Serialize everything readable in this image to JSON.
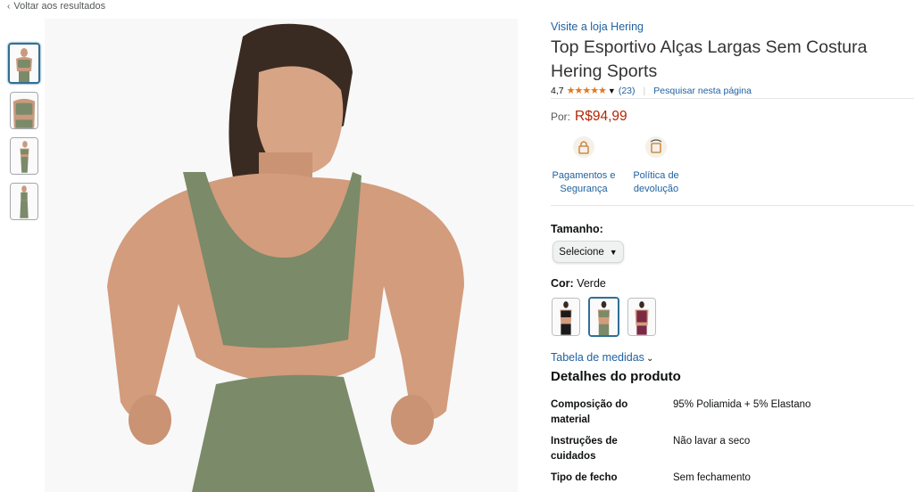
{
  "nav": {
    "back_label": "Voltar aos resultados"
  },
  "store_link": "Visite a loja Hering",
  "title": "Top Esportivo Alças Largas Sem Costura Hering Sports",
  "rating": {
    "value": "4,7",
    "stars": "★★★★★",
    "count": "(23)",
    "search_link": "Pesquisar nesta página"
  },
  "price": {
    "label": "Por:",
    "value": "R$94,99"
  },
  "features": [
    {
      "label": "Pagamentos e Segurança",
      "icon": "lock-card-icon"
    },
    {
      "label": "Política de devolução",
      "icon": "return-box-icon"
    }
  ],
  "size": {
    "label": "Tamanho:",
    "select_value": "Selecione"
  },
  "color": {
    "label": "Cor:",
    "value": "Verde",
    "swatches": [
      "#1a1a1a",
      "#7b8a68",
      "#7a2a45"
    ]
  },
  "size_chart_link": "Tabela de medidas",
  "details": {
    "heading": "Detalhes do produto",
    "rows": [
      {
        "k": "Composição do material",
        "v": "95% Poliamida + 5% Elastano"
      },
      {
        "k": "Instruções de cuidados",
        "v": "Não lavar a seco"
      },
      {
        "k": "Tipo de fecho",
        "v": "Sem fechamento"
      }
    ]
  },
  "colors": {
    "link": "#2162a1",
    "price": "#b12704",
    "star": "#de7921",
    "garment": "#7b8a68"
  }
}
